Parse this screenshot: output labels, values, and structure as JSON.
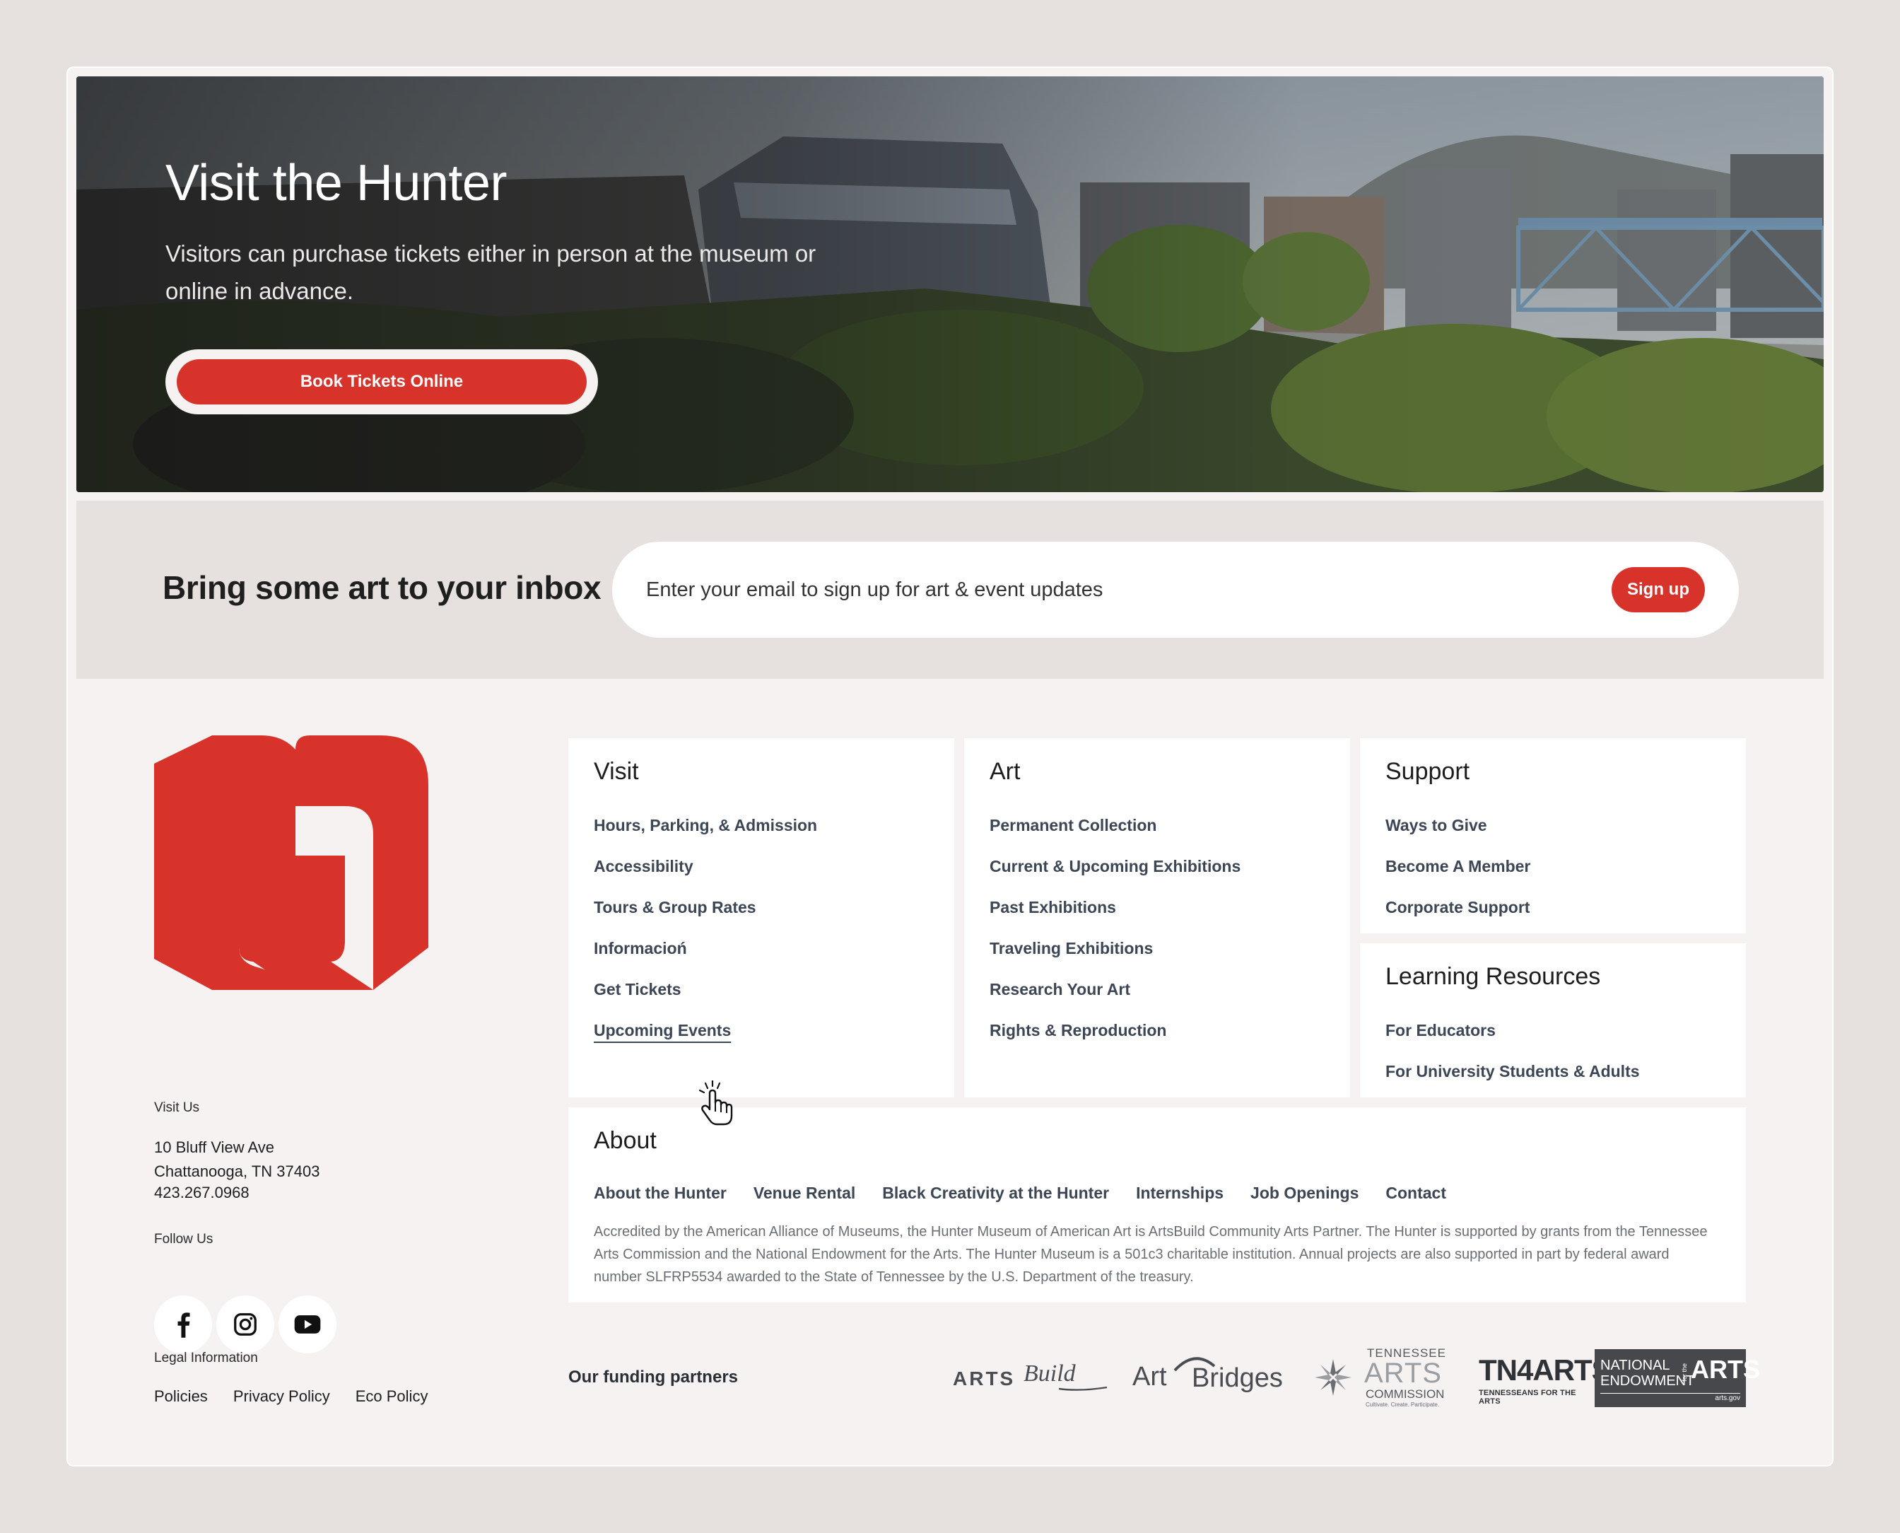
{
  "hero": {
    "title": "Visit the Hunter",
    "subtitle": "Visitors can purchase tickets either in person at the museum or online in advance.",
    "cta_label": "Book Tickets Online"
  },
  "newsletter": {
    "title": "Bring some art to your inbox",
    "placeholder": "Enter your email to sign up for art & event updates",
    "signup_label": "Sign up"
  },
  "contact": {
    "visit_label": "Visit Us",
    "address_line1": "10 Bluff View Ave",
    "address_line2": "Chattanooga, TN 37403",
    "phone": "423.267.0968",
    "follow_label": "Follow Us",
    "socials": [
      "facebook-icon",
      "instagram-icon",
      "youtube-icon"
    ]
  },
  "legal": {
    "label": "Legal Information",
    "links": [
      "Policies",
      "Privacy Policy",
      "Eco Policy"
    ]
  },
  "nav": {
    "visit": {
      "title": "Visit",
      "links": [
        "Hours, Parking, & Admission",
        "Accessibility",
        "Tours & Group Rates",
        "Informacioń",
        "Get Tickets",
        "Upcoming Events"
      ]
    },
    "art": {
      "title": "Art",
      "links": [
        "Permanent Collection",
        "Current & Upcoming Exhibitions",
        "Past Exhibitions",
        "Traveling Exhibitions",
        "Research Your Art",
        "Rights & Reproduction"
      ]
    },
    "support": {
      "title": "Support",
      "links": [
        "Ways to Give",
        "Become A Member",
        "Corporate Support"
      ]
    },
    "learning": {
      "title": "Learning Resources",
      "links": [
        "For Educators",
        "For University Students & Adults"
      ]
    },
    "about": {
      "title": "About",
      "links": [
        "About the Hunter",
        "Venue Rental",
        "Black Creativity at the Hunter",
        "Internships",
        "Job Openings",
        "Contact"
      ],
      "text": "Accredited by the American Alliance of Museums, the Hunter Museum of American Art is ArtsBuild Community Arts Partner. The Hunter is supported by grants from the Tennessee Arts Commission and the National Endowment for the Arts. The Hunter Museum is a 501c3 charitable institution. Annual projects are also supported in part by federal award number SLFRP5534 awarded to the State of Tennessee by the U.S. Department of the treasury."
    }
  },
  "funding": {
    "label": "Our funding partners",
    "partners": {
      "artsbuild": {
        "word": "ARTS",
        "script": "Build"
      },
      "artbridges": {
        "a": "Art",
        "b": "Bridges"
      },
      "tac": {
        "line1": "TENNESSEE",
        "line2": "ARTS",
        "line3": "COMMISSION",
        "tagline": "Cultivate. Create. Participate."
      },
      "tn4arts": {
        "main": "TN4ARTS",
        "sub": "TENNESSEANS FOR THE ARTS"
      },
      "nea": {
        "line1": "NATIONAL",
        "line2": "ENDOWMENT",
        "for_the": "for the",
        "arts": "ARTS",
        "url": "arts.gov"
      }
    }
  },
  "colors": {
    "accent": "#d7332b",
    "page_bg": "#e6e1de",
    "card_bg": "#f5f2f1",
    "link": "#3c4654"
  }
}
